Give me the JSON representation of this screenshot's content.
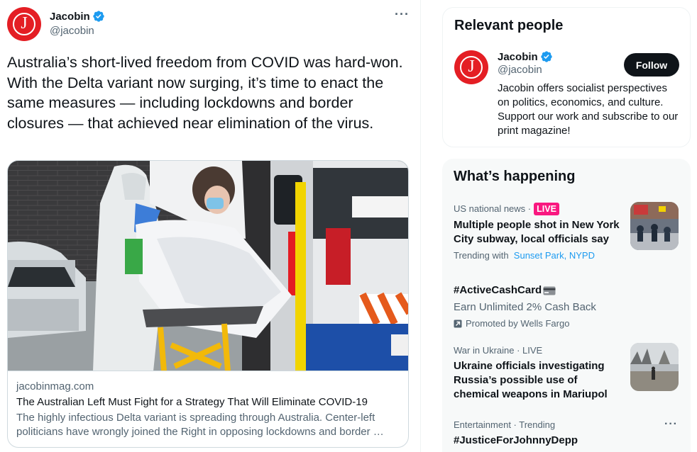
{
  "tweet": {
    "author_name": "Jacobin",
    "author_handle": "@jacobin",
    "avatar_letter": "J",
    "more_label": "···",
    "text": "Australia’s short-lived freedom from COVID was hard-won. With the Delta variant now surging, it’s time to enact the same measures — including lockdowns and border closures — that achieved near elimination of the virus.",
    "card": {
      "domain": "jacobinmag.com",
      "title": "The Australian Left Must Fight for a Strategy That Will Eliminate COVID-19",
      "description": "The highly infectious Delta variant is spreading through Australia. Center-left politicians have wrongly joined the Right in opposing lockdowns and border …"
    }
  },
  "relevant": {
    "title": "Relevant people",
    "name": "Jacobin",
    "handle": "@jacobin",
    "follow_label": "Follow",
    "bio": "Jacobin offers socialist perspectives on politics, economics, and culture. Support our work and subscribe to our print magazine!"
  },
  "happening": {
    "title": "What’s happening",
    "trends": [
      {
        "meta": "US national news ·",
        "badge": "LIVE",
        "title": "Multiple people shot in New York City subway, local officials say",
        "sub_prefix": "Trending with",
        "links": [
          "Sunset Park",
          ", ",
          "NYPD"
        ]
      },
      {
        "title": "#ActiveCashCard",
        "subtitle": "Earn Unlimited 2% Cash Back",
        "promoted": "Promoted by Wells Fargo"
      },
      {
        "meta": "War in Ukraine · LIVE",
        "title": "Ukraine officials investigating Russia’s possible use of chemical weapons in Mariupol"
      },
      {
        "meta": "Entertainment · Trending",
        "title": "#JusticeForJohnnyDepp",
        "more_label": "···"
      }
    ]
  },
  "colors": {
    "brand_red": "#e41e24",
    "verified_blue": "#1d9bf0",
    "live_pink": "#f91880",
    "text_primary": "#0f1419",
    "text_secondary": "#536471"
  },
  "icons": [
    "verified-badge-icon",
    "more-icon",
    "promoted-icon",
    "card-emoji-icon"
  ]
}
